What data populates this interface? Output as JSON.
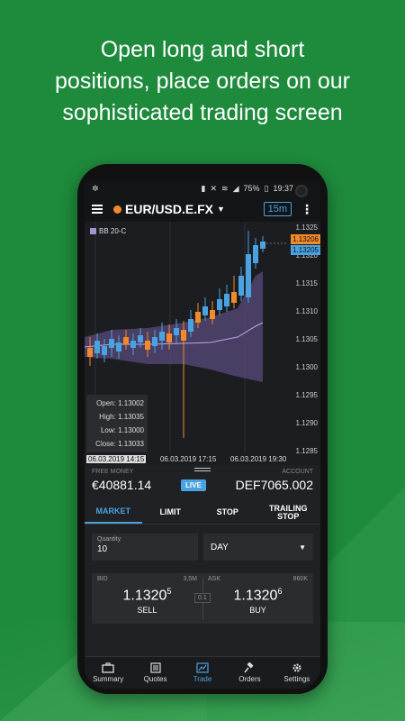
{
  "headline": [
    "Open long and short",
    "positions, place orders on our",
    "sophisticated trading screen"
  ],
  "statusbar": {
    "battery": "75%",
    "time": "19:37"
  },
  "appbar": {
    "pair": "EUR/USD.E.FX",
    "timeframe": "15m"
  },
  "chart": {
    "indicator": "BB 20-C",
    "price_ticks": [
      "1.1325",
      "1.1320",
      "1.1315",
      "1.1310",
      "1.1305",
      "1.1300",
      "1.1295",
      "1.1290",
      "1.1285"
    ],
    "ask_tag": "1.13206",
    "bid_tag": "1.13205",
    "ohlc": {
      "open": "Open: 1.13002",
      "high": "High: 1.13035",
      "low": "Low: 1.13000",
      "close": "Close: 1.13033"
    },
    "time_labels": [
      "06.03.2019 14:15",
      "06.03.2019 17:15",
      "06.03.2019 19:30"
    ],
    "colors": {
      "up": "#4aa3e0",
      "down": "#f08a2a",
      "band": "#5a4a7a"
    }
  },
  "info": {
    "free_money_label": "FREE MONEY",
    "free_money": "€40881.14",
    "account_label": "ACCOUNT",
    "account": "DEF7065.002",
    "live": "LIVE"
  },
  "tabs": [
    "MARKET",
    "LIMIT",
    "STOP",
    "TRAILING STOP"
  ],
  "order": {
    "quantity_label": "Quantity",
    "quantity": "10",
    "duration": "DAY"
  },
  "bid": {
    "label": "BID",
    "volume": "3,5M",
    "price_main": "1.1320",
    "price_sup": "5",
    "action": "SELL"
  },
  "ask": {
    "label": "ASK",
    "volume": "860K",
    "price_main": "1.1320",
    "price_sup": "6",
    "action": "BUY"
  },
  "spread": "0.1",
  "nav": [
    "Summary",
    "Quotes",
    "Trade",
    "Orders",
    "Settings"
  ]
}
